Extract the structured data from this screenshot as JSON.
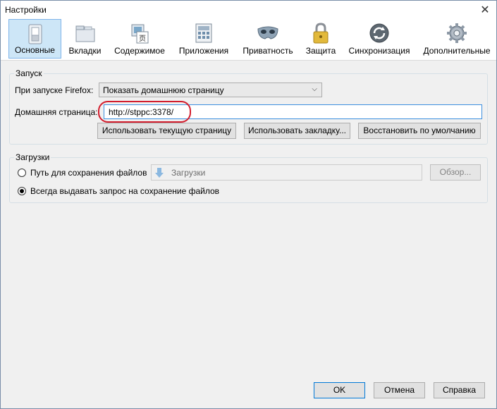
{
  "window": {
    "title": "Настройки"
  },
  "toolbar": {
    "items": [
      {
        "label": "Основные",
        "icon": "switch-icon"
      },
      {
        "label": "Вкладки",
        "icon": "tabs-icon"
      },
      {
        "label": "Содержимое",
        "icon": "content-icon"
      },
      {
        "label": "Приложения",
        "icon": "applications-icon"
      },
      {
        "label": "Приватность",
        "icon": "privacy-mask-icon"
      },
      {
        "label": "Защита",
        "icon": "padlock-icon"
      },
      {
        "label": "Синхронизация",
        "icon": "sync-icon"
      },
      {
        "label": "Дополнительные",
        "icon": "gear-icon"
      }
    ],
    "active_index": 0
  },
  "startup": {
    "legend": "Запуск",
    "when_starts_label": "При запуске Firefox:",
    "when_starts_value": "Показать домашнюю страницу",
    "homepage_label": "Домашняя страница:",
    "homepage_value": "http://stppc:3378/",
    "use_current_label": "Использовать текущую страницу",
    "use_bookmark_label": "Использовать закладку...",
    "restore_default_label": "Восстановить по умолчанию"
  },
  "downloads": {
    "legend": "Загрузки",
    "save_path_label": "Путь для сохранения файлов",
    "save_path_value": "Загрузки",
    "browse_label": "Обзор...",
    "always_ask_label": "Всегда выдавать запрос на сохранение файлов",
    "selected_option": "always_ask"
  },
  "footer": {
    "ok_label": "OK",
    "cancel_label": "Отмена",
    "help_label": "Справка"
  },
  "colors": {
    "active_tab_bg": "#cde6f7",
    "annotation": "#d21d2d",
    "focus_border": "#3b8ede"
  }
}
